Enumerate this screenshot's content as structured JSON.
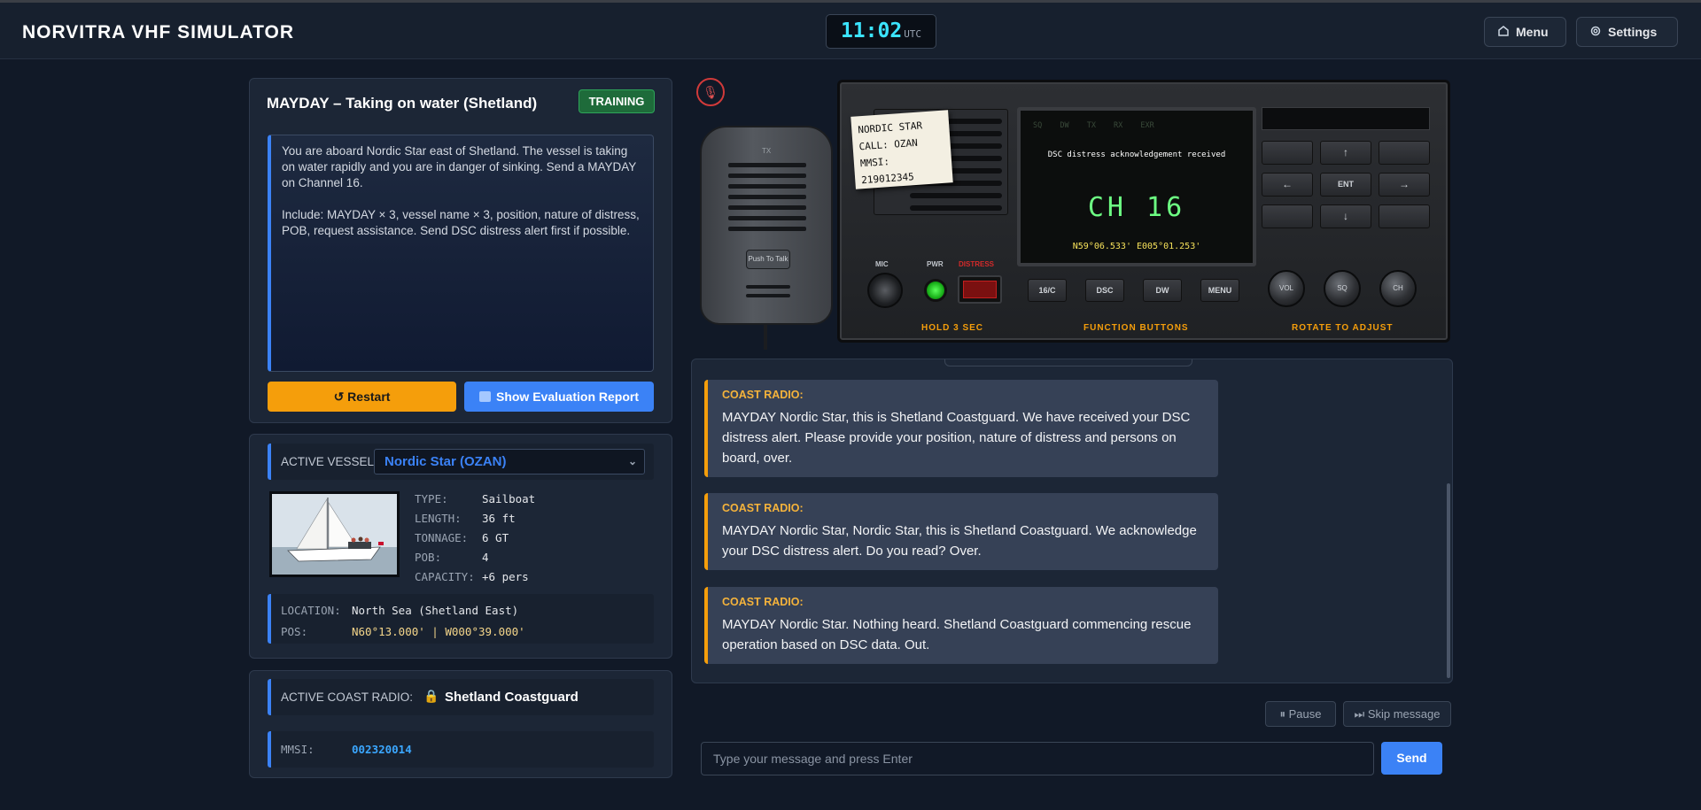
{
  "header": {
    "title": "NORVITRA VHF SIMULATOR",
    "clock_time": "11:02",
    "clock_zone": "UTC",
    "menu_label": "Menu",
    "settings_label": "Settings"
  },
  "scenario": {
    "title": "MAYDAY – Taking on water (Shetland)",
    "badge": "TRAINING",
    "brief_p1": "You are aboard Nordic Star east of Shetland. The vessel is taking on water rapidly and you are in danger of sinking. Send a MAYDAY on Channel 16.",
    "brief_p2": "Include: MAYDAY × 3, vessel name × 3, position, nature of distress, POB, request assistance. Send DSC distress alert first if possible.",
    "restart_label": "↺ Restart",
    "eval_label": "Show Evaluation Report"
  },
  "vessel": {
    "label": "ACTIVE VESSEL:",
    "selected": "Nordic Star (OZAN)",
    "specs": [
      {
        "k": "TYPE:",
        "v": "Sailboat"
      },
      {
        "k": "LENGTH:",
        "v": "36 ft"
      },
      {
        "k": "TONNAGE:",
        "v": "6 GT"
      },
      {
        "k": "POB:",
        "v": "4"
      },
      {
        "k": "CAPACITY:",
        "v": "+6 pers"
      }
    ],
    "location_label": "LOCATION:",
    "location": "North Sea (Shetland East)",
    "pos_label": "POS:",
    "pos": "N60°13.000' | W000°39.000'"
  },
  "coast": {
    "label": "ACTIVE COAST RADIO:",
    "name": "Shetland Coastguard",
    "mmsi_label": "MMSI:",
    "mmsi": "002320014"
  },
  "radio": {
    "note_line1": "NORDIC STAR",
    "note_line2": "CALL: OZAN",
    "note_line3": "MMSI: 219012345",
    "lcd_status": "SQ DW TX RX EXR",
    "lcd_message": "DSC distress acknowledgement received",
    "lcd_channel": "CH 16",
    "lcd_position": "N59°06.533' E005°01.253'",
    "ptt_label": "Push To Talk",
    "handset_logo": "TX",
    "mic_label": "MIC",
    "pwr_label": "PWR",
    "distress_label": "DISTRESS",
    "hold_label": "HOLD 3 SEC",
    "function_label": "FUNCTION BUTTONS",
    "rotate_label": "ROTATE TO ADJUST",
    "btn_1616c": "16/C",
    "btn_dsc": "DSC",
    "btn_dw": "DW",
    "btn_menu": "MENU",
    "knob_vol": "VOL",
    "knob_sq": "SQ",
    "knob_ch": "CH",
    "key_up": "↑",
    "key_down": "↓",
    "key_left": "←",
    "key_right": "→",
    "key_ent": "ENT"
  },
  "chat": {
    "messages": [
      {
        "sender": "COAST RADIO:",
        "text": "MAYDAY Nordic Star, this is Shetland Coastguard. We have received your DSC distress alert. Please provide your position, nature of distress and persons on board, over."
      },
      {
        "sender": "COAST RADIO:",
        "text": "MAYDAY Nordic Star, Nordic Star, this is Shetland Coastguard. We acknowledge your DSC distress alert. Do you read? Over."
      },
      {
        "sender": "COAST RADIO:",
        "text": "MAYDAY Nordic Star. Nothing heard. Shetland Coastguard commencing rescue operation based on DSC data. Out."
      }
    ],
    "pause_label": "⏸ Pause",
    "skip_label": "⏭ Skip message",
    "input_placeholder": "Type your message and press Enter",
    "input_value": "",
    "send_label": "Send"
  },
  "colors": {
    "accent": "#3b82f6",
    "warning": "#f59e0b",
    "success": "#1e6b3a",
    "lcd_green": "#6dff83"
  }
}
